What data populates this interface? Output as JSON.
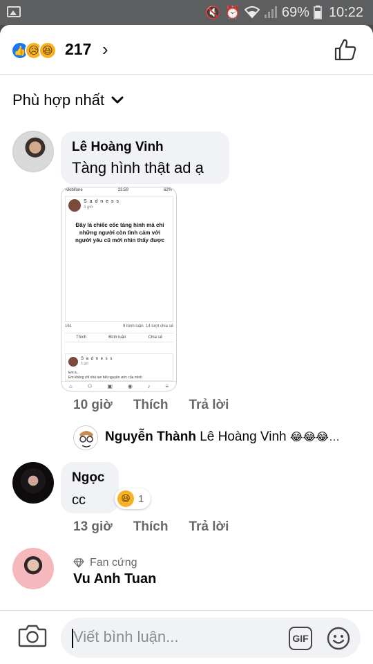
{
  "statusbar": {
    "battery": "69%",
    "time": "10:22"
  },
  "header": {
    "reaction_count": "217",
    "reactions": [
      "like",
      "sad",
      "haha"
    ]
  },
  "sort": {
    "label": "Phù hợp nhất"
  },
  "comments": [
    {
      "author": "Lê Hoàng Vinh",
      "text": "Tàng hình thật ad ạ",
      "time": "10 giờ",
      "like_label": "Thích",
      "reply_label": "Trả lời",
      "attachment": {
        "carrier": "Mobifone",
        "clock": "23:59",
        "battery": "62%",
        "post_author": "S a d n e s s",
        "post_time": "3 giờ",
        "post_text": "Đây là chiếc cốc tàng hình mà chỉ những người còn tình cảm với người yêu cũ mới nhìn thấy được",
        "reactions": "161",
        "comments": "9 bình luận",
        "shares": "14 lượt chia sẻ",
        "action_like": "Thích",
        "action_comment": "Bình luận",
        "action_share": "Chia sẻ",
        "post2_author": "S a d n e s s",
        "post2_time": "5 giờ",
        "post2_line1": "Em à...",
        "post2_line2": "Em không chỉ nhà tan hết nguyện ước của mình"
      },
      "reply_preview": {
        "author": "Nguyễn Thành",
        "text": "Lê Hoàng Vinh",
        "emojis": "😂😂😂…"
      }
    },
    {
      "author": "Ngọc",
      "text": "cc",
      "time": "13 giờ",
      "like_label": "Thích",
      "reply_label": "Trả lời",
      "reaction_count": "1"
    },
    {
      "badge": "Fan cứng",
      "author": "Vu Anh Tuan"
    }
  ],
  "composer": {
    "placeholder": "Viết bình luận...",
    "gif_label": "GIF"
  },
  "colors": {
    "like_blue": "#1877f2",
    "emoji_yellow": "#f7b125",
    "bubble_gray": "#f0f2f5",
    "meta_gray": "#65676b"
  }
}
